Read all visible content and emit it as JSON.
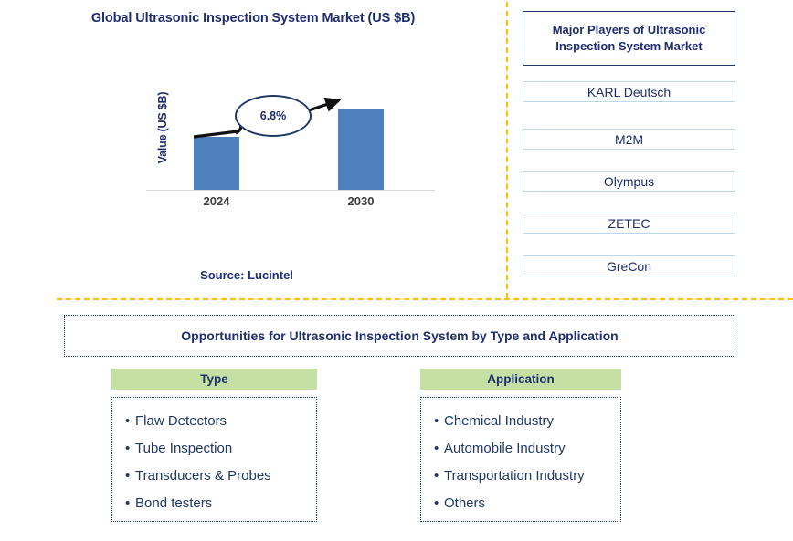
{
  "chart_panel": {
    "title": "Global Ultrasonic Inspection System Market (US $B)",
    "source": "Source: Lucintel"
  },
  "chart_data": {
    "type": "bar",
    "title": "Global Ultrasonic Inspection System Market (US $B)",
    "categories": [
      "2024",
      "2030"
    ],
    "values": [
      58,
      88
    ],
    "xlabel": "",
    "ylabel": "Value (US $B)",
    "grid": false,
    "legend": "none",
    "annotations": [
      {
        "text": "6.8%",
        "kind": "cagr-callout",
        "from_category": "2024",
        "to_category": "2030"
      }
    ],
    "series": [
      {
        "name": "Value (US $B)",
        "values": [
          58,
          88
        ]
      }
    ],
    "bar_color": "#4E80BD",
    "axis_label_color": "#3F3F3F",
    "title_color": "#1F2E6E"
  },
  "players_panel": {
    "header": "Major Players of Ultrasonic Inspection System Market",
    "items": [
      {
        "label": "KARL Deutsch"
      },
      {
        "label": "M2M"
      },
      {
        "label": "Olympus"
      },
      {
        "label": "ZETEC"
      },
      {
        "label": "GreCon"
      }
    ]
  },
  "opportunities": {
    "banner": "Opportunities for Ultrasonic Inspection System by Type and Application",
    "bullet": "•",
    "columns": [
      {
        "header": "Type",
        "items": [
          "Flaw Detectors",
          "Tube Inspection",
          "Transducers & Probes",
          "Bond testers"
        ]
      },
      {
        "header": "Application",
        "items": [
          "Chemical Industry",
          "Automobile Industry",
          "Transportation Industry",
          "Others"
        ]
      }
    ]
  },
  "theme": {
    "navy": "#1F2E6E",
    "dark_navy": "#1F3864",
    "bar_blue": "#4E80BD",
    "divider_gold": "#FFC000",
    "header_green": "#C6E0A4",
    "box_border_blue": "#BDD7EE"
  }
}
